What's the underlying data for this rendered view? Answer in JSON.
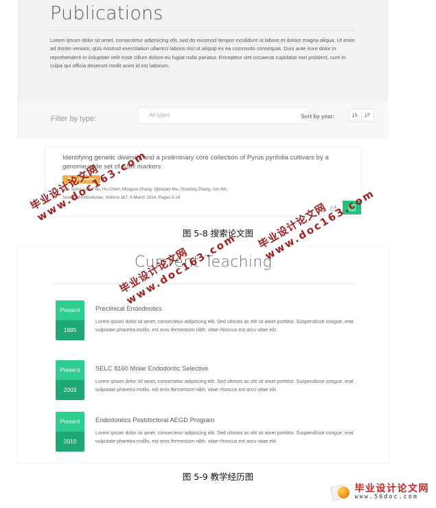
{
  "publications_figure": {
    "title": "Publications",
    "lead_paragraph": "Lorem ipsum dolor sit amet, consectetur adipisicing elit, sed do eiusmod tempor incididunt ut labore et dolore magna aliqua. Ut enim ad minim veniam, quis nostrud exercitation ullamco laboris nisi ut aliquip ex ea commodo consequat. Duis aute irure dolor in reprehenderit in voluptate velit esse cillum dolore eu fugiat nulla pariatur. Excepteur sint occaecat cupidatat non proident, sunt in culpa qui officia deserunt mollit anim id est laborum.",
    "filter": {
      "label": "Filter by type:",
      "selected_value": "All types"
    },
    "sort": {
      "label": "Sort by year:",
      "ascending_icon": "sort-amount-asc-icon",
      "descending_icon": "sort-amount-desc-icon"
    },
    "card": {
      "title": "Identifying genetic diversity and a preliminary core collection of Pyrus pyrifolia cultivars by a genome-wide set of SSR markers",
      "badge": "Book Chapter",
      "badge_color": "#f0ad4e",
      "authors": "Yue Song, Lian Fan, Hui Chen, Mingyue Zhang, Qianqian Ma, Shaoling Zhang, Jun Wu",
      "journal": "Scientia Horticulturae, Volume 167, 6 March 2014, Pages 5-16",
      "actions": {
        "open_link_icon": "external-link-icon",
        "add_icon": "add-box-icon",
        "add_color": "#24c281"
      }
    }
  },
  "teaching_figure": {
    "title": "Currrent Teaching",
    "items": [
      {
        "period_top": "Present",
        "period_bottom": "1995",
        "heading": "Preclinical Endodnotics",
        "body": "Lorem ipsum dolor sit amet, consectetur adipiscing elit. Sed ultrices ac elit sit amet porttitor. Suspendisse congue, erat vulputate pharetra mollis, est eros fermentum nibh, vitae rhoncus est arcu vitae elit."
      },
      {
        "period_top": "Present",
        "period_bottom": "2003",
        "heading": "SELC 8160 Molar Endodontic Selective",
        "body": "Lorem ipsum dolor sit amet, consectetur adipiscing elit. Sed ultrices ac elit sit amet porttitor. Suspendisse congue, erat vulputate pharetra mollis, est eros fermentum nibh, vitae rhoncus est arcu vitae elit."
      },
      {
        "period_top": "Present",
        "period_bottom": "2010",
        "heading": "Endodontics Postdoctoral AEGD Program",
        "body": "Lorem ipsum dolor sit amet, consectetur adipiscing elit. Sed ultrices ac elit sit amet porttitor. Suspendisse congue, erat vulputate pharetra mollis, est eros fermentum nibh, vitae rhoncus est arcu vitae elit."
      }
    ],
    "badge_color_top": "#2ecc8f",
    "badge_color_bottom": "#1fa873"
  },
  "captions": {
    "figure_5_8": "图 5-8  搜索论文图",
    "figure_5_9": "图 5-9  教学经历图"
  },
  "watermarks": {
    "line1": "毕业设计论文网",
    "line2": "www.doc163.com",
    "color": "#9c1414"
  },
  "footer_logo": {
    "name_cn": "毕业设计论文网",
    "url": "www.56doc.com"
  }
}
